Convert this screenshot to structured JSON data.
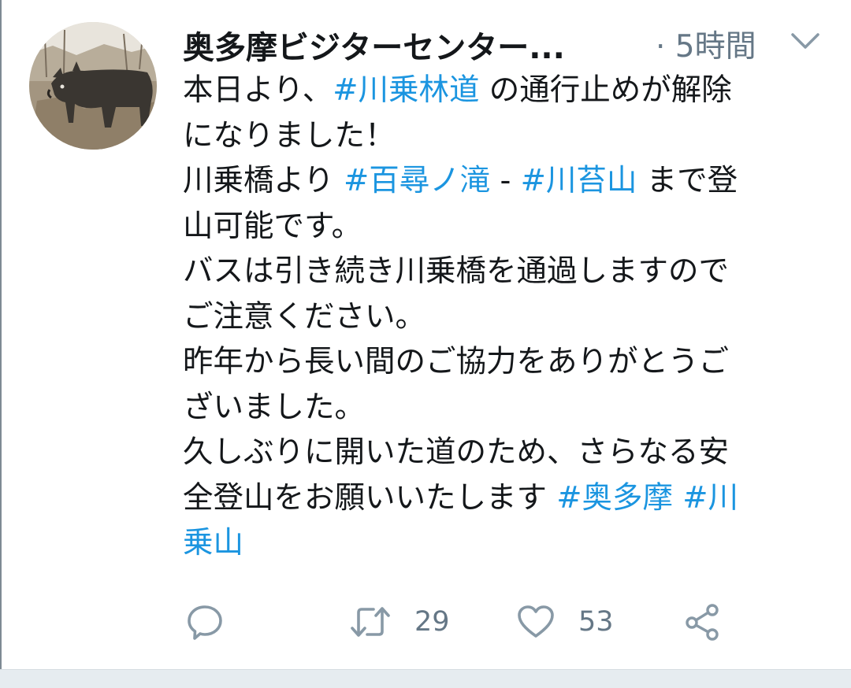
{
  "tweet": {
    "author": {
      "display_name": "奥多摩ビジターセンター..."
    },
    "timestamp": "· 5時間",
    "body_lines": [
      [
        {
          "t": "本日より、"
        },
        {
          "t": "#川乗林道",
          "tag": true
        },
        {
          "t": " の通行止めが解除"
        }
      ],
      [
        {
          "t": "になりました！"
        }
      ],
      [
        {
          "t": "川乗橋より "
        },
        {
          "t": "#百尋ノ滝",
          "tag": true
        },
        {
          "t": " - "
        },
        {
          "t": "#川苔山",
          "tag": true
        },
        {
          "t": " まで登"
        }
      ],
      [
        {
          "t": "山可能です。"
        }
      ],
      [
        {
          "t": "バスは引き続き川乗橋を通過しますので"
        }
      ],
      [
        {
          "t": "ご注意ください。"
        }
      ],
      [
        {
          "t": "昨年から長い間のご協力をありがとうご"
        }
      ],
      [
        {
          "t": "ざいました。"
        }
      ],
      [
        {
          "t": "久しぶりに開いた道のため、さらなる安"
        }
      ],
      [
        {
          "t": "全登山をお願いいたします "
        },
        {
          "t": "#奥多摩",
          "tag": true
        },
        {
          "t": " "
        },
        {
          "t": "#川",
          "tag": true
        }
      ],
      [
        {
          "t": "乗山",
          "tag": true
        }
      ]
    ],
    "actions": {
      "reply_icon": "reply-icon",
      "retweet_icon": "retweet-icon",
      "retweet_count": "29",
      "like_icon": "heart-icon",
      "like_count": "53",
      "share_icon": "share-icon"
    },
    "colors": {
      "hashtag": "#1b95e0",
      "secondary_text": "#657786",
      "primary_text": "#14171a"
    }
  }
}
